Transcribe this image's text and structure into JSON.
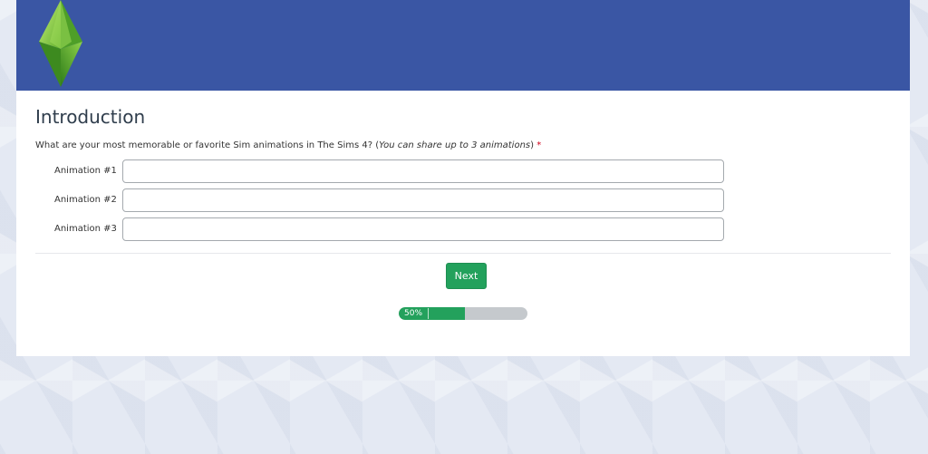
{
  "colors": {
    "banner": "#3a56a4",
    "accent": "#23a15c",
    "required": "#d0021b",
    "progress_track": "#c5c9cd"
  },
  "header": {
    "logo_icon": "plumbob-icon"
  },
  "page": {
    "title": "Introduction"
  },
  "question": {
    "text": "What are your most memorable or favorite Sim animations in The Sims 4? (",
    "hint": "You can share up to 3 animations",
    "close": ")",
    "required_mark": "*"
  },
  "fields": [
    {
      "label": "Animation #1",
      "value": ""
    },
    {
      "label": "Animation #2",
      "value": ""
    },
    {
      "label": "Animation #3",
      "value": ""
    }
  ],
  "actions": {
    "next_label": "Next"
  },
  "progress": {
    "fraction": 0.5,
    "label": "50%"
  }
}
